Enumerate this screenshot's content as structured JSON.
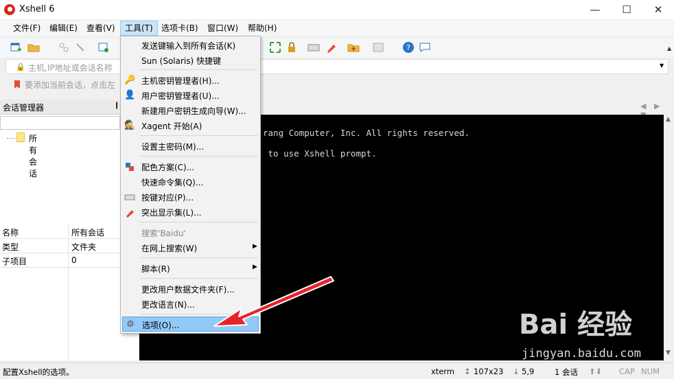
{
  "window": {
    "title": "Xshell 6",
    "minimize": "—",
    "maximize": "☐",
    "close": "✕"
  },
  "menubar": [
    {
      "label": "文件(F)"
    },
    {
      "label": "编辑(E)"
    },
    {
      "label": "查看(V)"
    },
    {
      "label": "工具(T)"
    },
    {
      "label": "选项卡(B)"
    },
    {
      "label": "窗口(W)"
    },
    {
      "label": "帮助(H)"
    }
  ],
  "address": {
    "placeholder": "主机,IP地址或会话名称",
    "hint": "要添加当前会话，点击左"
  },
  "session_manager": {
    "title": "会话管理器",
    "pin": "❙",
    "tree_root": "所有会话"
  },
  "properties": [
    {
      "key": "名称",
      "value": "所有会话"
    },
    {
      "key": "类型",
      "value": "文件夹"
    },
    {
      "key": "子项目",
      "value": "0"
    }
  ],
  "terminal": {
    "line1": "rang Computer, Inc. All rights reserved.",
    "line2": " to use Xshell prompt."
  },
  "tools_menu": {
    "items": [
      {
        "label": "发送键输入到所有会话(K)",
        "icon": ""
      },
      {
        "label": "Sun (Solaris) 快捷键",
        "icon": ""
      },
      {
        "label": "主机密钥管理者(H)...",
        "icon": "host-key-icon"
      },
      {
        "label": "用户密钥管理者(U)...",
        "icon": "user-key-icon"
      },
      {
        "label": "新建用户密钥生成向导(W)...",
        "icon": ""
      },
      {
        "label": "Xagent 开始(A)",
        "icon": "xagent-icon"
      },
      {
        "label": "设置主密码(M)...",
        "icon": ""
      },
      {
        "label": "配色方案(C)...",
        "icon": "color-scheme-icon"
      },
      {
        "label": "快速命令集(Q)...",
        "icon": ""
      },
      {
        "label": "按键对应(P)...",
        "icon": "keyboard-icon"
      },
      {
        "label": "突出显示集(L)...",
        "icon": "highlight-pen-icon"
      },
      {
        "label": "搜索'Baidu'",
        "icon": ""
      },
      {
        "label": "在网上搜索(W)",
        "icon": ""
      },
      {
        "label": "脚本(R)",
        "icon": ""
      },
      {
        "label": "更改用户数据文件夹(F)...",
        "icon": ""
      },
      {
        "label": "更改语言(N)...",
        "icon": ""
      },
      {
        "label": "选项(O)...",
        "icon": "gear-icon"
      }
    ]
  },
  "statusbar": {
    "message": "配置Xshell的选项。",
    "term_type": "xterm",
    "size": "107x23",
    "cursor": "5,9",
    "sessions": "1 会话",
    "cap": "CAP",
    "num": "NUM"
  },
  "watermark": {
    "logo": "Bai 经验",
    "url": "jingyan.baidu.com"
  },
  "colors": {
    "accent_highlight": "#91c9f7",
    "arrow_red": "#e8232a",
    "terminal_bg": "#000000"
  }
}
